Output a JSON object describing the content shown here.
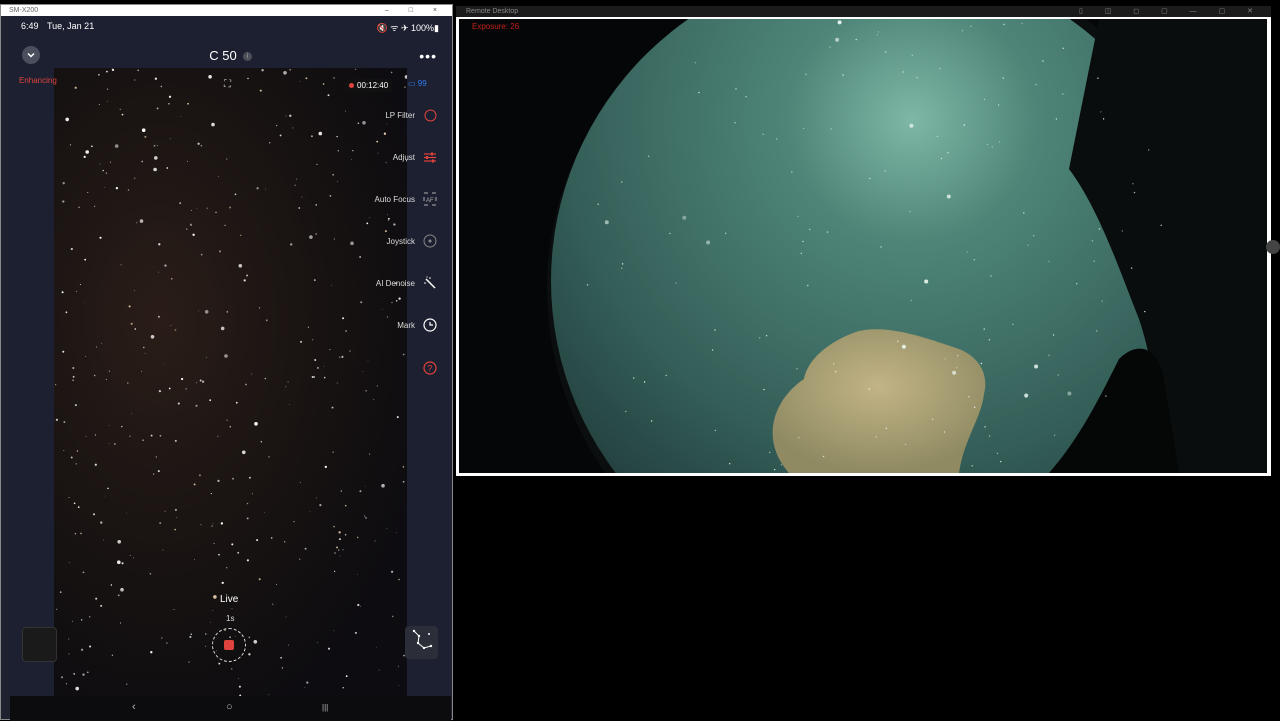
{
  "phone_window": {
    "title": "SM-X200",
    "controls": "– □ ×"
  },
  "status_bar": {
    "time": "6:49",
    "date": "Tue, Jan 21",
    "indicators": "🔇 ᯤ ✈ 100%▮"
  },
  "header": {
    "title": "C 50",
    "info_icon": "i",
    "more": "•••"
  },
  "overlay": {
    "enhancing": "Enhancing",
    "recording_time": "00:12:40",
    "battery_value": "99",
    "battery_icon": "▭"
  },
  "tools": [
    {
      "label": "LP Filter",
      "icon": "circle-outline-icon"
    },
    {
      "label": "Adjust",
      "icon": "sliders-icon"
    },
    {
      "label": "Auto Focus",
      "icon": "af-icon"
    },
    {
      "label": "Joystick",
      "icon": "joystick-icon"
    },
    {
      "label": "AI Denoise",
      "icon": "magic-wand-icon"
    },
    {
      "label": "Mark",
      "icon": "target-icon"
    },
    {
      "label": "",
      "icon": "help-icon"
    }
  ],
  "capture": {
    "mode": "Live",
    "exposure": "1s"
  },
  "nav": {
    "back": "‹",
    "home": "○",
    "recents": "|||"
  },
  "allsky_window": {
    "title": "Remote Desktop",
    "controls": "▯ ◫ ◻ ▢ — ▢ ✕",
    "exposure_label": "Exposure: 26"
  },
  "colors": {
    "accent_red": "#e0433c",
    "battery_blue": "#2f7bf0",
    "sky_cyan": "#3f6b63",
    "cloud": "#a89a6c"
  }
}
